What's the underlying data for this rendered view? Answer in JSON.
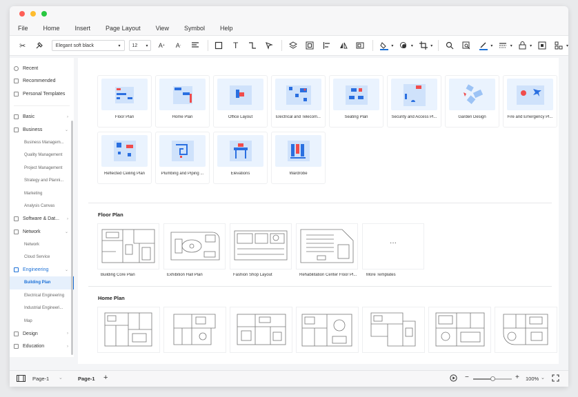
{
  "menu": [
    "File",
    "Home",
    "Insert",
    "Page Layout",
    "View",
    "Symbol",
    "Help"
  ],
  "toolbar": {
    "font": "Elegant soft black",
    "font_size": "12",
    "icons": [
      "scissors-icon",
      "format-painter-icon",
      "font-increase-icon",
      "font-decrease-icon",
      "align-icon",
      "rectangle-icon",
      "text-icon",
      "connector-icon",
      "pointer-icon",
      "layers-icon",
      "group-icon",
      "align-left-icon",
      "flip-icon",
      "fit-icon",
      "fill-color-icon",
      "shadow-icon",
      "crop-icon",
      "search-icon",
      "replace-icon",
      "line-color-icon",
      "line-style-icon",
      "lock-icon",
      "frame-icon",
      "more-icon"
    ]
  },
  "sidebar": {
    "top": [
      "Recent",
      "Recommended",
      "Personal Templates"
    ],
    "categories": [
      {
        "label": "Basic",
        "expanded": false,
        "children": []
      },
      {
        "label": "Business",
        "expanded": true,
        "children": [
          "Business Managem...",
          "Quality Management",
          "Project Management",
          "Strategy and Planni...",
          "Marketing",
          "Analysis Canvas"
        ]
      },
      {
        "label": "Software & Dat...",
        "expanded": false,
        "children": []
      },
      {
        "label": "Network",
        "expanded": true,
        "children": [
          "Network",
          "Cloud Service"
        ]
      },
      {
        "label": "Engineering",
        "expanded": true,
        "active": true,
        "children": [
          "Building Plan",
          "Electrical Engineering",
          "Industrial Engineeri...",
          "Map"
        ]
      },
      {
        "label": "Design",
        "expanded": false,
        "children": []
      },
      {
        "label": "Education",
        "expanded": false,
        "children": []
      }
    ],
    "active_child": "Building Plan"
  },
  "categories_grid": [
    "Floor Plan",
    "Home Plan",
    "Office Layout",
    "Electrical and Telecom...",
    "Seating Plan",
    "Security and Access Pl...",
    "Garden Design",
    "Fire and Emergency Pl...",
    "Reflected Ceiling Plan",
    "Plumbing and Piping ...",
    "Elevations",
    "Wardrobe"
  ],
  "sections": {
    "floor_plan": {
      "title": "Floor Plan",
      "templates": [
        "Building Core Plan",
        "Exhibition Hall Plan",
        "Fashion Shop Layout",
        "Rehabilitation Center Floor Pl...",
        "More Templates"
      ]
    },
    "home_plan": {
      "title": "Home Plan"
    }
  },
  "statusbar": {
    "page_select": "Page-1",
    "page_tab": "Page-1",
    "add": "+",
    "zoom_minus": "−",
    "zoom_plus": "+",
    "zoom": "100%",
    "zoom_level": 0.5
  },
  "colors": {
    "accent": "#1a6fd6",
    "thumb_bg": "#eaf3fe",
    "red": "#f04c4c",
    "blue": "#2a6fe0"
  }
}
